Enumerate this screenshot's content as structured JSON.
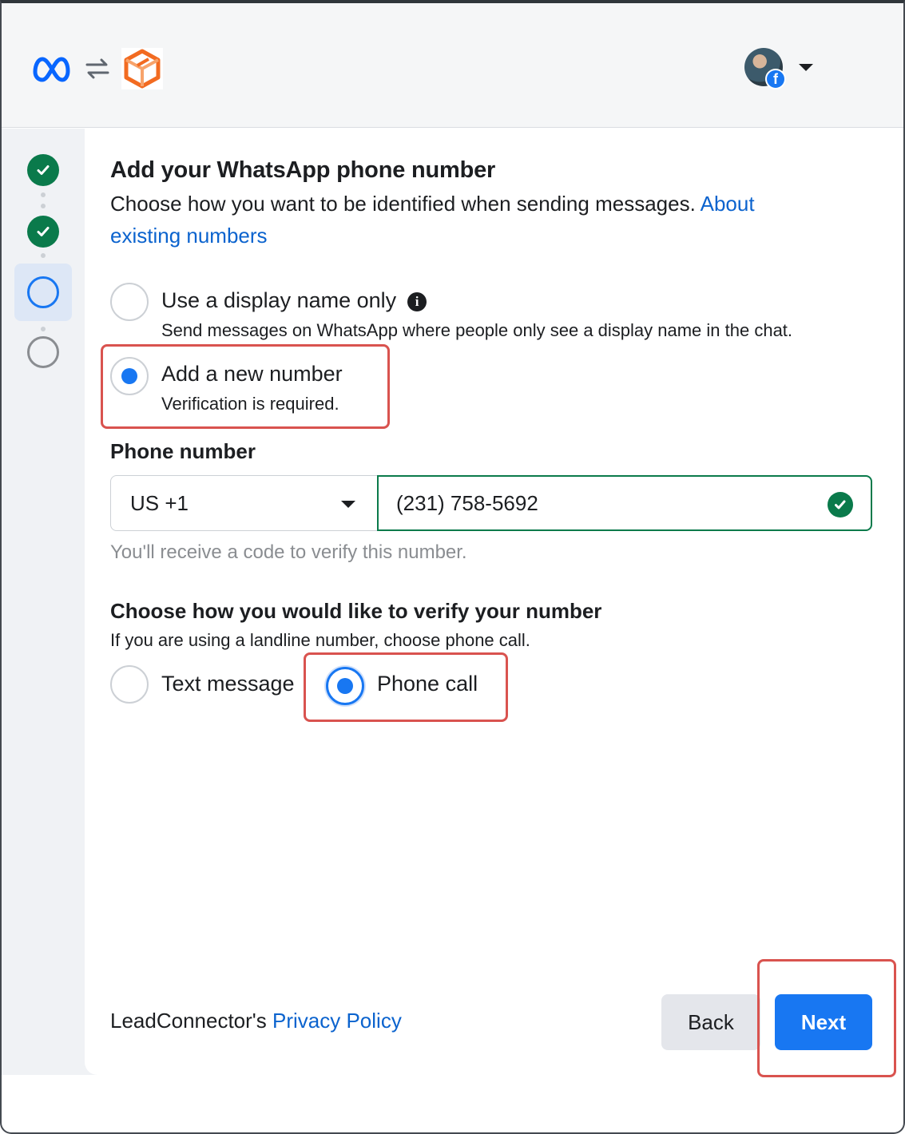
{
  "header": {
    "logos": [
      "meta-logo",
      "sync-arrows-icon",
      "leadconnector-logo"
    ],
    "account_icons": [
      "avatar",
      "facebook-badge-icon",
      "caret-down-icon"
    ]
  },
  "steps": [
    {
      "state": "done",
      "icon": "checkmark-icon"
    },
    {
      "state": "done",
      "icon": "checkmark-icon"
    },
    {
      "state": "active"
    },
    {
      "state": "pending"
    }
  ],
  "page": {
    "title": "Add your WhatsApp phone number",
    "subtitle": "Choose how you want to be identified when sending messages.",
    "subtitle_link": "About existing numbers"
  },
  "identity_options": [
    {
      "title": "Use a display name only",
      "description": "Send messages on WhatsApp where people only see a display name in the chat.",
      "selected": false
    },
    {
      "title": "Add a new number",
      "description": "Verification is required.",
      "selected": true
    }
  ],
  "phone": {
    "label": "Phone number",
    "country_code": "US +1",
    "number": "(231) 758-5692",
    "hint": "You'll receive a code to verify this number."
  },
  "verify": {
    "heading": "Choose how you would like to verify your number",
    "description": "If you are using a landline number, choose phone call.",
    "options": [
      {
        "label": "Text message",
        "selected": false
      },
      {
        "label": "Phone call",
        "selected": true
      }
    ]
  },
  "footer": {
    "company": "LeadConnector's",
    "policy_link": "Privacy Policy",
    "back_label": "Back",
    "next_label": "Next"
  },
  "colors": {
    "accent": "#1877f2",
    "success": "#0a7a4b",
    "link": "#0b63ce",
    "highlight": "#d9534f"
  }
}
